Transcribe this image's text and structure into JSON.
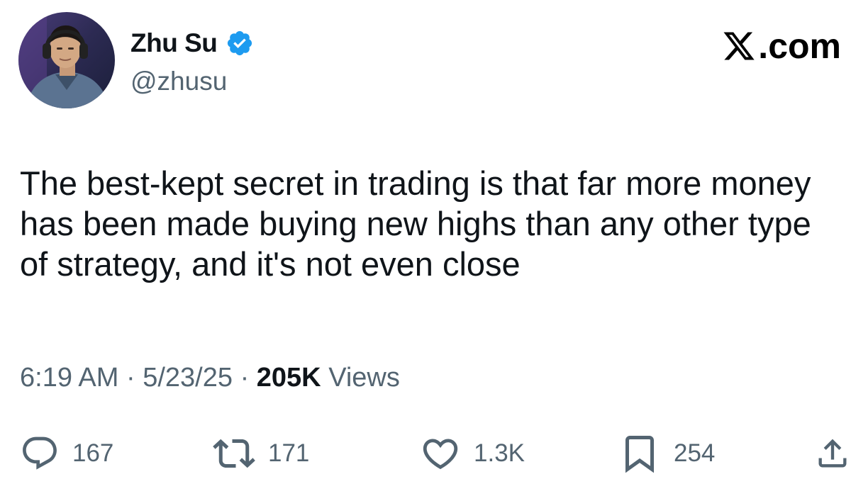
{
  "author": {
    "name": "Zhu Su",
    "handle": "@zhusu",
    "verified": true
  },
  "brand": {
    "label": ".com",
    "icon": "x-logo-icon"
  },
  "tweet": {
    "text": "The best-kept secret in trading is that far more money has been made buying new highs than any other type of strategy, and it's not even close"
  },
  "meta": {
    "time": "6:19 AM",
    "separator": "·",
    "date": "5/23/25",
    "views_count": "205K",
    "views_label": "Views"
  },
  "actions": {
    "replies": {
      "icon": "reply-icon",
      "count": "167"
    },
    "reposts": {
      "icon": "repost-icon",
      "count": "171"
    },
    "likes": {
      "icon": "heart-icon",
      "count": "1.3K"
    },
    "bookmarks": {
      "icon": "bookmark-icon",
      "count": "254"
    },
    "share": {
      "icon": "share-icon"
    }
  },
  "colors": {
    "text_primary": "#0f1419",
    "text_secondary": "#536471",
    "verified_blue": "#1d9bf0"
  }
}
